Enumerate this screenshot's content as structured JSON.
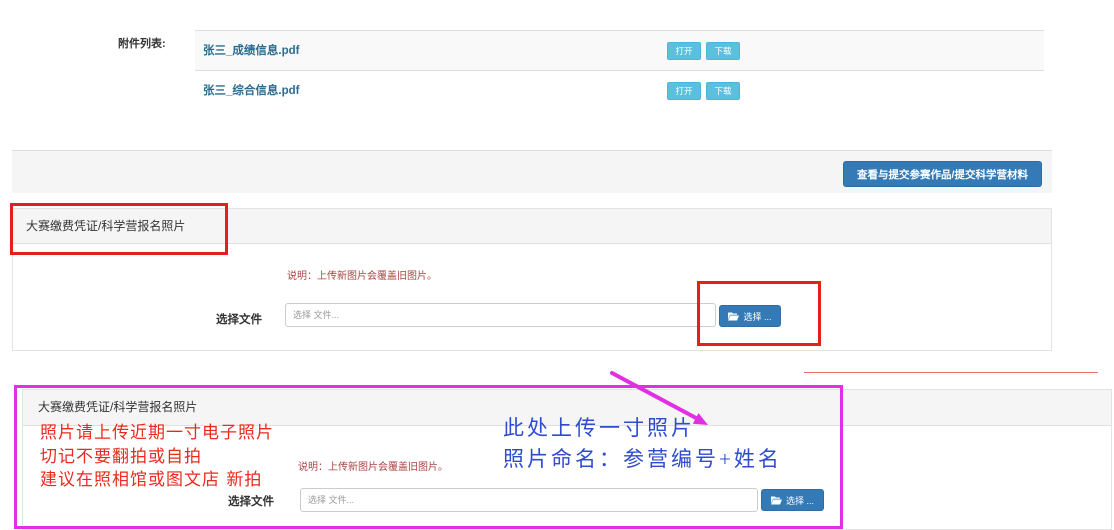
{
  "attachments": {
    "label": "附件列表:",
    "files": [
      {
        "name": "张三_成绩信息.pdf",
        "open_label": "打开",
        "download_label": "下载"
      },
      {
        "name": "张三_综合信息.pdf",
        "open_label": "打开",
        "download_label": "下载"
      }
    ]
  },
  "footer": {
    "submit_label": "查看与提交参赛作品/提交科学营材料"
  },
  "upload_panels": [
    {
      "title": "大赛缴费凭证/科学营报名照片",
      "note": "说明：上传新图片会覆盖旧图片。",
      "file_label": "选择文件",
      "placeholder": "选择 文件...",
      "choose_label": "选择 ...",
      "choose_icon": "folder-open-icon"
    },
    {
      "title": "大赛缴费凭证/科学营报名照片",
      "note": "说明：上传新图片会覆盖旧图片。",
      "file_label": "选择文件",
      "placeholder": "选择 文件...",
      "choose_label": "选择 ...",
      "choose_icon": "folder-open-icon"
    }
  ],
  "annotations": {
    "red_notes": [
      "照片请上传近期一寸电子照片",
      "切记不要翻拍或自拍",
      "建议在照相馆或图文店 新拍"
    ],
    "blue_notes": [
      "此处上传一寸照片",
      "照片命名：参营编号+姓名"
    ]
  },
  "colors": {
    "primary": "#337ab7",
    "info": "#5bc0de",
    "note": "#a94442",
    "anno_red_box": "#e3201b",
    "anno_red_text": "#ea2a1f",
    "anno_blue": "#2f4ccf",
    "anno_magenta": "#e12fe3"
  }
}
